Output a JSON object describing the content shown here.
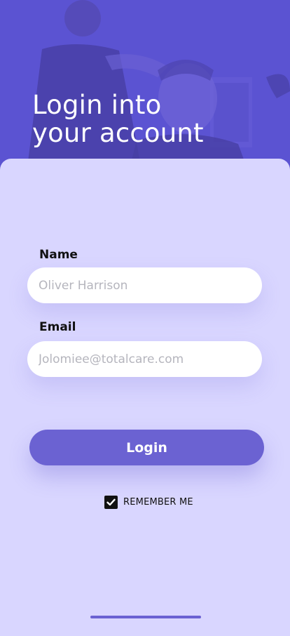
{
  "hero": {
    "title_line1": "Login into",
    "title_line2": "your account"
  },
  "form": {
    "name": {
      "label": "Name",
      "placeholder": "Oliver Harrison",
      "value": ""
    },
    "email": {
      "label": "Email",
      "placeholder": "Jolomiee@totalcare.com",
      "value": ""
    },
    "login_label": "Login",
    "remember_label": "REMEMBER ME",
    "remember_checked": true
  },
  "colors": {
    "accent": "#6b62d2",
    "background": "#d9d6ff",
    "hero_tint": "#5c54d6"
  }
}
